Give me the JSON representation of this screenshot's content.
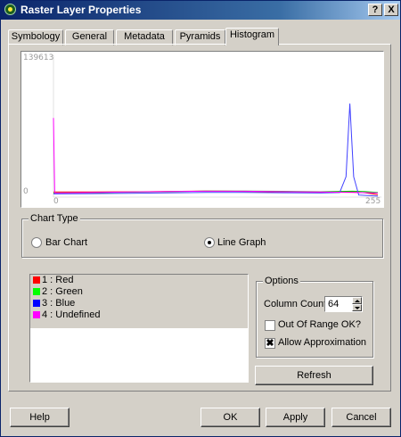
{
  "window": {
    "title": "Raster Layer Properties",
    "help_glyph": "?",
    "close_glyph": "X",
    "app_icon": "qgis-icon"
  },
  "tabs": [
    {
      "label": "Symbology",
      "active": false
    },
    {
      "label": "General",
      "active": false
    },
    {
      "label": "Metadata",
      "active": false
    },
    {
      "label": "Pyramids",
      "active": false
    },
    {
      "label": "Histogram",
      "active": true
    }
  ],
  "histogram": {
    "y_max_label": "139613",
    "y_min_label": "0",
    "x_min_label": "0",
    "x_max_label": "255"
  },
  "chart_data": {
    "type": "line",
    "title": "",
    "xlabel": "",
    "ylabel": "",
    "xlim": [
      0,
      255
    ],
    "ylim": [
      0,
      139613
    ],
    "series": [
      {
        "name": "1 : Red",
        "color": "#ff0000",
        "points": [
          [
            0,
            5000
          ],
          [
            30,
            5000
          ],
          [
            60,
            5200
          ],
          [
            90,
            5600
          ],
          [
            120,
            6000
          ],
          [
            150,
            5600
          ],
          [
            180,
            5200
          ],
          [
            210,
            4900
          ],
          [
            235,
            4800
          ],
          [
            245,
            4300
          ],
          [
            255,
            2500
          ]
        ]
      },
      {
        "name": "2 : Green",
        "color": "#00d000",
        "points": [
          [
            0,
            4000
          ],
          [
            30,
            4300
          ],
          [
            60,
            4800
          ],
          [
            90,
            5400
          ],
          [
            120,
            5900
          ],
          [
            150,
            6000
          ],
          [
            180,
            5700
          ],
          [
            210,
            5300
          ],
          [
            235,
            5800
          ],
          [
            245,
            5500
          ],
          [
            255,
            4500
          ]
        ]
      },
      {
        "name": "3 : Blue",
        "color": "#4040ff",
        "points": [
          [
            0,
            3200
          ],
          [
            30,
            3400
          ],
          [
            60,
            3700
          ],
          [
            90,
            4200
          ],
          [
            120,
            4600
          ],
          [
            150,
            4600
          ],
          [
            180,
            4300
          ],
          [
            210,
            4000
          ],
          [
            225,
            4500
          ],
          [
            230,
            20000
          ],
          [
            233,
            92000
          ],
          [
            236,
            20000
          ],
          [
            240,
            2000
          ],
          [
            255,
            1000
          ]
        ]
      },
      {
        "name": "4 : Undefined",
        "color": "#ff00ff",
        "points": [
          [
            0,
            78000
          ],
          [
            1,
            4000
          ],
          [
            30,
            4500
          ],
          [
            60,
            5000
          ],
          [
            90,
            5500
          ],
          [
            120,
            5800
          ],
          [
            150,
            5800
          ],
          [
            180,
            5400
          ],
          [
            210,
            5000
          ],
          [
            235,
            4600
          ],
          [
            255,
            4000
          ]
        ]
      }
    ]
  },
  "chart_type": {
    "title": "Chart Type",
    "bar_label": "Bar Chart",
    "line_label": "Line Graph",
    "selected": "line"
  },
  "bands": [
    {
      "label": "1 : Red",
      "color": "#ff0000"
    },
    {
      "label": "2 : Green",
      "color": "#00ff00"
    },
    {
      "label": "3 : Blue",
      "color": "#0000ff"
    },
    {
      "label": "4 : Undefined",
      "color": "#ff00ff"
    }
  ],
  "options": {
    "title": "Options",
    "column_count_label": "Column Count:",
    "column_count_value": "64",
    "out_of_range_label": "Out Of Range OK?",
    "out_of_range_checked": false,
    "allow_approx_label": "Allow Approximation",
    "allow_approx_checked": true,
    "checkmark": "✖"
  },
  "buttons": {
    "refresh": "Refresh",
    "help": "Help",
    "ok": "OK",
    "apply": "Apply",
    "cancel": "Cancel"
  }
}
